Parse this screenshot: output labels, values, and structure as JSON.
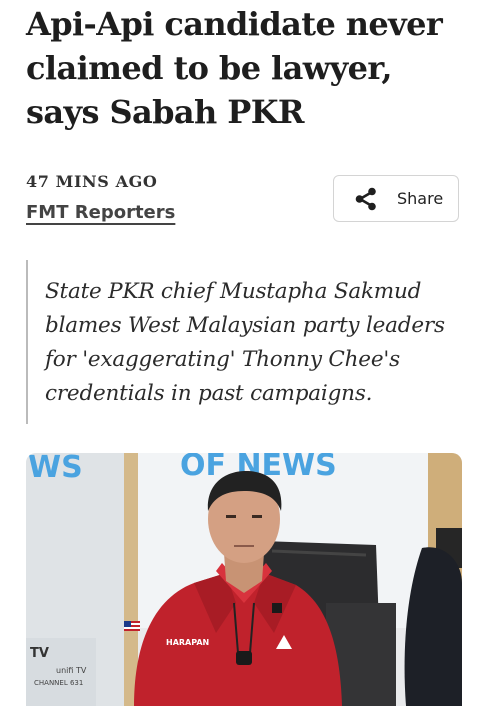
{
  "article": {
    "headline": "Api-Api candidate never claimed to be lawyer, says Sabah PKR",
    "timestamp": "47 MINS AGO",
    "author": "FMT Reporters",
    "standfirst": "State PKR chief Mustapha Sakmud blames West Malaysian party leaders for 'exaggerating' Thonny Chee's credentials in past campaigns."
  },
  "share": {
    "label": "Share",
    "icon": "share-icon"
  },
  "hero_image": {
    "backdrop_text_left": "WS",
    "backdrop_text_right": "OF NEWS",
    "shirt_badge": "HARAPAN",
    "screen_text_tv": "TV",
    "screen_text_unifi": "unifi TV",
    "screen_text_channel": "CHANNEL 631"
  },
  "colors": {
    "shirt": "#c0222c",
    "backdrop_blue": "#4aa3e0",
    "chair": "#2c2c2e"
  }
}
